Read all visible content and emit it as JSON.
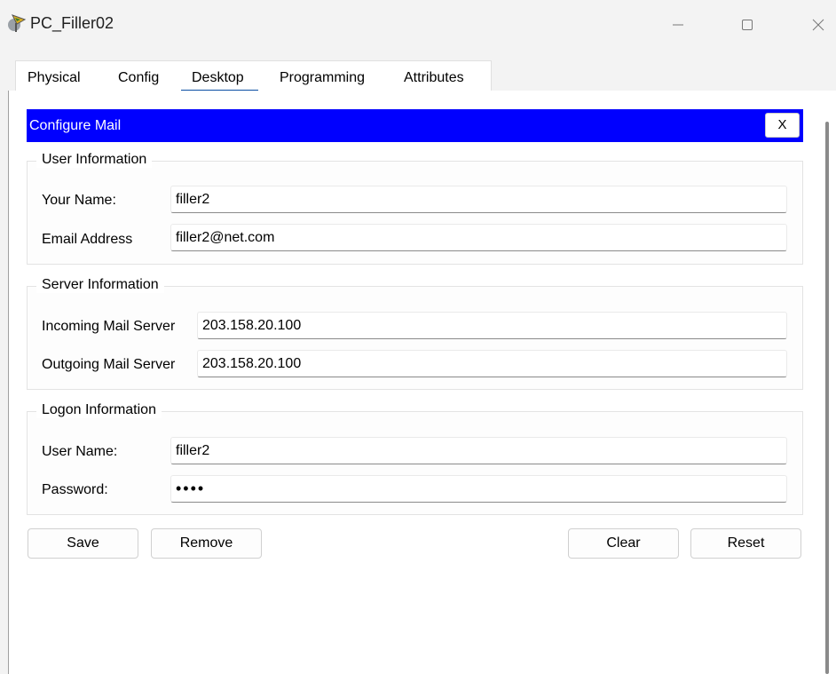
{
  "window": {
    "title": "PC_Filler02",
    "icon": "pc-app-icon",
    "controls": [
      "minimize-icon",
      "maximize-icon",
      "close-icon"
    ]
  },
  "tabs": [
    {
      "label": "Physical"
    },
    {
      "label": "Config"
    },
    {
      "label": "Desktop",
      "active": true
    },
    {
      "label": "Programming"
    },
    {
      "label": "Attributes"
    }
  ],
  "mail": {
    "title": "Configure Mail",
    "close_label": "X",
    "user_info": {
      "legend": "User Information",
      "name_label": "Your Name:",
      "name_value": "filler2",
      "email_label": "Email Address",
      "email_value": "filler2@net.com"
    },
    "server_info": {
      "legend": "Server Information",
      "incoming_label": "Incoming Mail Server",
      "incoming_value": "203.158.20.100",
      "outgoing_label": "Outgoing Mail Server",
      "outgoing_value": "203.158.20.100"
    },
    "logon_info": {
      "legend": "Logon Information",
      "username_label": "User Name:",
      "username_value": "filler2",
      "password_label": "Password:",
      "password_value": "••••"
    },
    "buttons": {
      "save": "Save",
      "remove": "Remove",
      "clear": "Clear",
      "reset": "Reset"
    }
  },
  "colors": {
    "header_bg": "#0000ff",
    "header_text": "#ffffff",
    "tab_underline": "#0a4ea3"
  }
}
